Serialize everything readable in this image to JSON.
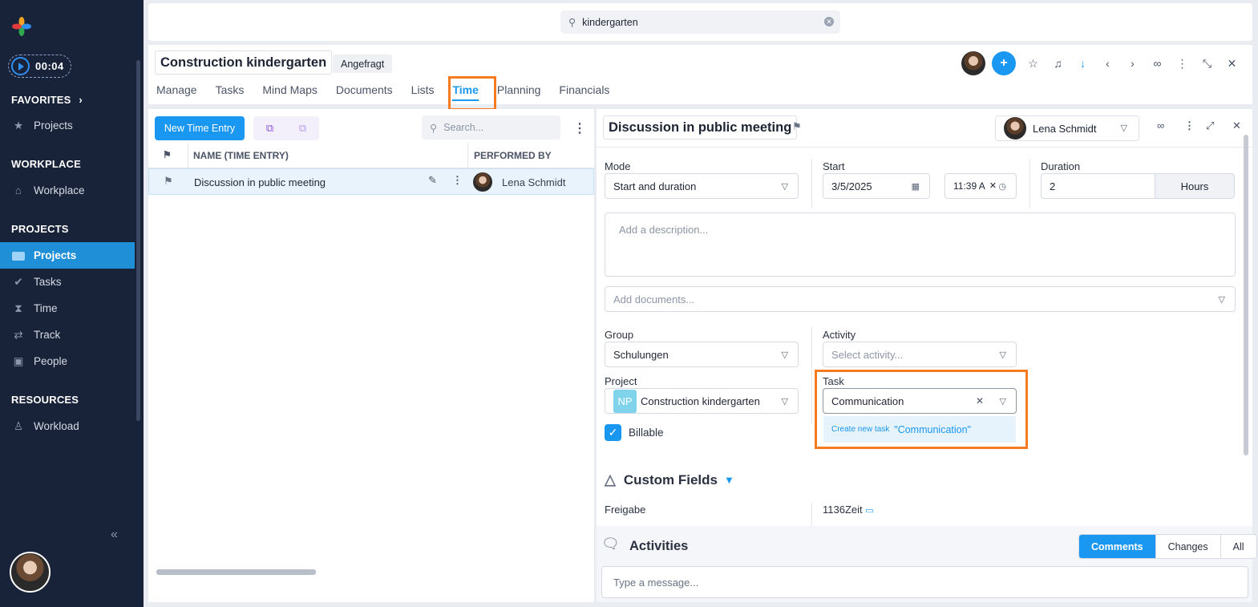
{
  "search": {
    "value": "kindergarten"
  },
  "timer": {
    "value": "00:04"
  },
  "sidebar": {
    "favorites_head": "FAVORITES",
    "favorites": [
      {
        "label": "Projects"
      }
    ],
    "workplace_head": "WORKPLACE",
    "workplace": [
      {
        "label": "Workplace"
      }
    ],
    "projects_head": "PROJECTS",
    "projects": [
      {
        "label": "Projects"
      },
      {
        "label": "Tasks"
      },
      {
        "label": "Time"
      },
      {
        "label": "Track"
      },
      {
        "label": "People"
      }
    ],
    "resources_head": "RESOURCES",
    "resources": [
      {
        "label": "Workload"
      }
    ]
  },
  "project": {
    "title": "Construction kindergarten",
    "status": "Angefragt",
    "tabs": [
      "Manage",
      "Tasks",
      "Mind Maps",
      "Documents",
      "Lists",
      "Time",
      "Planning",
      "Financials"
    ],
    "active_tab": "Time"
  },
  "list": {
    "new_button": "New Time Entry",
    "search_placeholder": "Search...",
    "columns": [
      "NAME (TIME ENTRY)",
      "PERFORMED BY"
    ],
    "rows": [
      {
        "name": "Discussion in public meeting",
        "performed_by": "Lena Schmidt"
      }
    ]
  },
  "detail": {
    "title": "Discussion in public meeting",
    "assignee": "Lena Schmidt",
    "mode_label": "Mode",
    "mode_value": "Start and duration",
    "start_label": "Start",
    "start_date": "3/5/2025",
    "start_time": "11:39 A",
    "duration_label": "Duration",
    "duration_value": "2",
    "duration_unit": "Hours",
    "description_placeholder": "Add a description...",
    "documents_placeholder": "Add documents...",
    "group_label": "Group",
    "group_value": "Schulungen",
    "activity_label": "Activity",
    "activity_placeholder": "Select activity...",
    "project_label": "Project",
    "project_initials": "NP",
    "project_value": "Construction kindergarten",
    "task_label": "Task",
    "task_value": "Communication",
    "create_task_prefix": "Create new task",
    "create_task_value": "\"Communication\"",
    "billable_label": "Billable",
    "custom_fields_title": "Custom Fields",
    "freigabe_label": "Freigabe",
    "zeit_label": "1136Zeit",
    "activities_title": "Activities",
    "activity_tabs": [
      "Comments",
      "Changes",
      "All"
    ],
    "message_placeholder": "Type a message..."
  },
  "colors": {
    "accent": "#1a97f0",
    "highlight": "#f47b20",
    "sidebar": "#182238"
  }
}
